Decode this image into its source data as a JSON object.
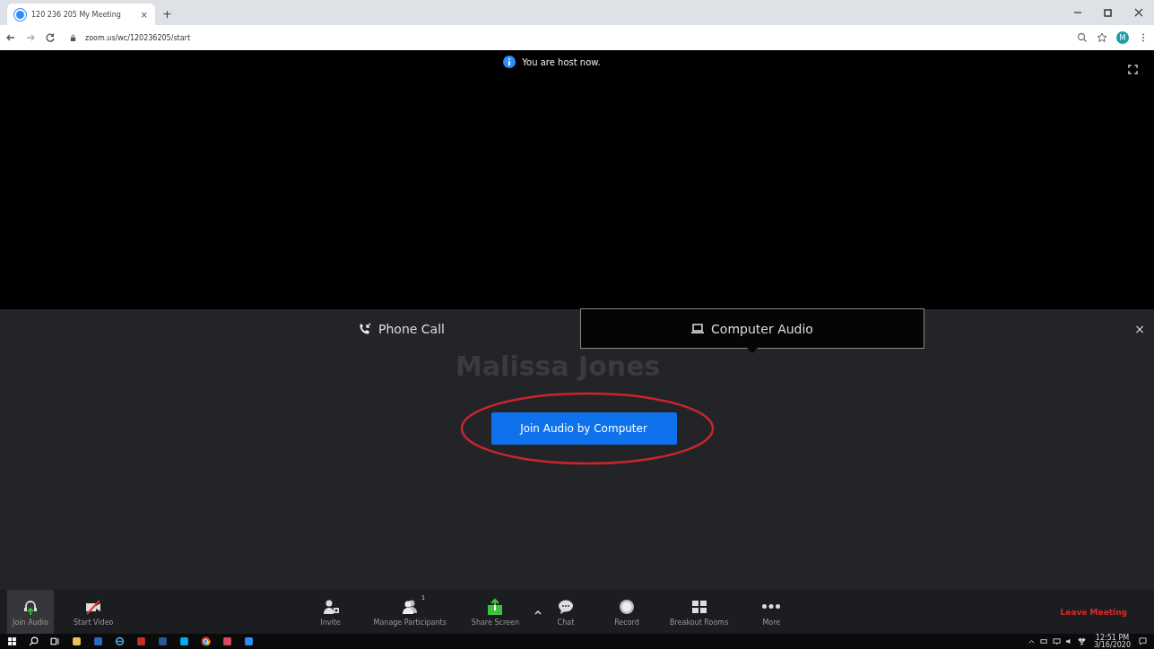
{
  "browser": {
    "tab_title": "120 236 205 My Meeting",
    "tab_close": "×",
    "new_tab": "+",
    "url": "zoom.us/wc/120236205/start",
    "avatar": "M"
  },
  "notice": "You are host now.",
  "participant_name": "Malissa Jones",
  "audio_tabs": [
    {
      "kind": "phone",
      "label": "Phone Call",
      "selected": false
    },
    {
      "kind": "computer",
      "label": "Computer Audio",
      "selected": true
    }
  ],
  "close": "×",
  "join_button": {
    "label": "Join Audio by Computer",
    "highlighted": true
  },
  "toolbar": [
    {
      "kind": "audio",
      "label": "Join Audio",
      "selected": true
    },
    {
      "kind": "video",
      "label": "Start Video",
      "selected": false
    },
    {
      "kind": "spacer"
    },
    {
      "kind": "invite",
      "label": "Invite",
      "selected": false
    },
    {
      "kind": "participants",
      "label": "Manage Participants",
      "count": "1",
      "selected": false
    },
    {
      "kind": "share",
      "label": "Share Screen",
      "selected": false
    },
    {
      "kind": "caret"
    },
    {
      "kind": "chat",
      "label": "Chat",
      "selected": false
    },
    {
      "kind": "record",
      "label": "Record",
      "selected": false
    },
    {
      "kind": "breakout",
      "label": "Breakout Rooms",
      "selected": false
    },
    {
      "kind": "more",
      "label": "More",
      "selected": false
    }
  ],
  "leave": "Leave Meeting",
  "taskbar": {
    "apps": [
      {
        "kind": "start"
      },
      {
        "kind": "search"
      },
      {
        "kind": "taskview"
      },
      {
        "kind": "app",
        "color": "#e8c35a"
      },
      {
        "kind": "app",
        "color": "#1f6fc5"
      },
      {
        "kind": "ie"
      },
      {
        "kind": "app",
        "color": "#c4302b"
      },
      {
        "kind": "app",
        "color": "#2b5797"
      },
      {
        "kind": "app",
        "color": "#00aff0"
      },
      {
        "kind": "chrome"
      },
      {
        "kind": "app",
        "color": "#d94a5a"
      },
      {
        "kind": "app",
        "color": "#2d8cff"
      }
    ],
    "time": "12:51 PM",
    "date": "3/16/2020"
  }
}
